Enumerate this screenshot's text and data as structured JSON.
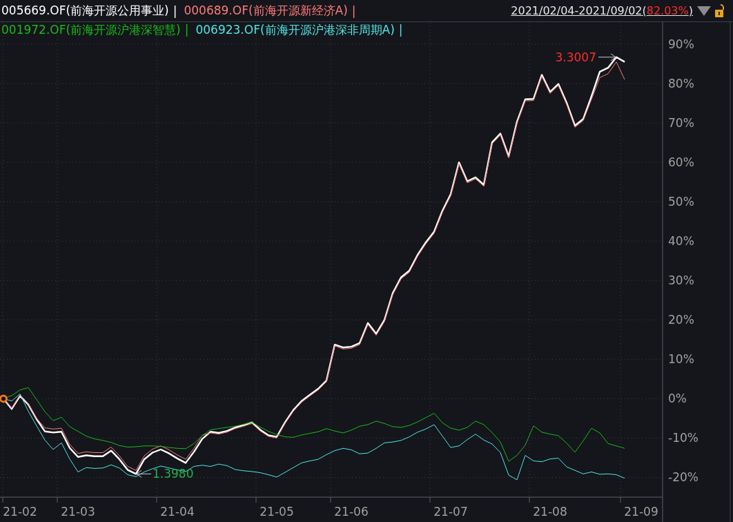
{
  "legend_separator": "|",
  "range": {
    "period": "2021/02/04-2021/09/02",
    "open": "(",
    "change": "82.03%",
    "close": ")"
  },
  "chart_data": {
    "type": "line",
    "grid": true,
    "ylim": [
      -25,
      95.6
    ],
    "categories": [
      null,
      null,
      "21-02",
      null,
      null,
      null,
      null,
      null,
      null,
      "21-03",
      null,
      null,
      null,
      null,
      null,
      null,
      null,
      null,
      null,
      null,
      null,
      "21-04",
      null,
      null,
      null,
      null,
      null,
      null,
      null,
      null,
      null,
      null,
      null,
      "21-05",
      null,
      null,
      null,
      null,
      null,
      null,
      null,
      null,
      "21-06",
      null,
      null,
      null,
      null,
      null,
      null,
      null,
      null,
      null,
      null,
      null,
      "21-07",
      null,
      null,
      null,
      null,
      null,
      null,
      null,
      null,
      null,
      null,
      null,
      "21-08",
      null,
      null,
      null,
      null,
      null,
      null,
      null,
      null,
      null,
      null,
      "21-09",
      null
    ],
    "yticks": [
      {
        "value": -20,
        "label": "-20%"
      },
      {
        "value": -10,
        "label": "-10%"
      },
      {
        "value": 0,
        "label": "0%"
      },
      {
        "value": 10,
        "label": "10%"
      },
      {
        "value": 20,
        "label": "20%"
      },
      {
        "value": 30,
        "label": "30%"
      },
      {
        "value": 40,
        "label": "40%"
      },
      {
        "value": 50,
        "label": "50%"
      },
      {
        "value": 60,
        "label": "60%"
      },
      {
        "value": 70,
        "label": "70%"
      },
      {
        "value": 80,
        "label": "80%"
      },
      {
        "value": 90,
        "label": "90%"
      }
    ],
    "series": [
      {
        "name": "005669.OF(前海开源公用事业)",
        "color": "#ffffff",
        "values": [
          0,
          -2.6,
          0.7,
          -1.5,
          -5.2,
          -8.3,
          -8.6,
          -8.4,
          -12.5,
          -14.8,
          -14.4,
          -14.6,
          -14.6,
          -13.2,
          -15.4,
          -18.1,
          -19.1,
          -15.4,
          -13.7,
          -12.9,
          -13.9,
          -15.2,
          -16.3,
          -13.5,
          -10.2,
          -8.4,
          -8.7,
          -8.2,
          -7.3,
          -6.7,
          -6,
          -7.9,
          -9.3,
          -9.7,
          -6,
          -2.9,
          -0.6,
          1,
          2.5,
          4.6,
          13.7,
          13,
          13.2,
          14.1,
          19.2,
          16.5,
          20,
          26.8,
          30.8,
          32.5,
          36.5,
          39.7,
          42.4,
          47.7,
          51.9,
          60,
          55.2,
          56.2,
          54.3,
          65.1,
          67.3,
          61.5,
          70.3,
          76,
          76.1,
          82.2,
          77.9,
          79.9,
          75.1,
          69.3,
          71,
          76.8,
          83,
          84,
          86.7,
          85.5,
          null,
          null,
          null
        ]
      },
      {
        "name": "000689.OF(前海开源新经济A)",
        "color": "#ff7b7b",
        "values": [
          0,
          -2.4,
          0.9,
          -1.3,
          -5,
          -7.4,
          -7.7,
          -7.5,
          -11.6,
          -13.9,
          -13.5,
          -13.7,
          -13.7,
          -12.3,
          -14.5,
          -17.2,
          -18.2,
          -14.5,
          -12.8,
          -12,
          -13,
          -14.3,
          -15.4,
          -12.6,
          -9.3,
          -8.7,
          -9,
          -8.5,
          -7.6,
          -7,
          -6.3,
          -8.2,
          -9.6,
          -10,
          -6.3,
          -3.2,
          -0.9,
          0.7,
          2.2,
          4.3,
          13.4,
          12.6,
          12.8,
          13.7,
          18.8,
          16.1,
          19.6,
          26.4,
          30.4,
          32.1,
          36.1,
          39.3,
          42,
          47.3,
          51.5,
          59.6,
          54.8,
          55.8,
          53.9,
          64.7,
          66.9,
          61.1,
          69.9,
          75.6,
          75.7,
          81.8,
          77.5,
          79.5,
          74.7,
          68.9,
          70.6,
          76,
          81.5,
          82.5,
          85.5,
          81,
          null,
          null,
          null
        ]
      },
      {
        "name": "001972.OF(前海开源沪港深智慧)",
        "color": "#19b919",
        "values": [
          0,
          0.8,
          2.2,
          2.8,
          -0.2,
          -3.3,
          -5.6,
          -4.7,
          -7.1,
          -8.3,
          -9.5,
          -10.2,
          -10.6,
          -11.1,
          -11.9,
          -12.3,
          -12.2,
          -12,
          -12,
          -12.1,
          -12.4,
          -12.6,
          -12.7,
          -11.4,
          -9.4,
          -7.9,
          -7.6,
          -7.3,
          -7,
          -6.5,
          -6,
          -7.2,
          -8.3,
          -9.1,
          -9.7,
          -9.8,
          -9.2,
          -8.8,
          -8.4,
          -7.6,
          -8.2,
          -8.7,
          -8,
          -7,
          -6.6,
          -5.7,
          -6.3,
          -7.1,
          -7.3,
          -6.8,
          -5.9,
          -4.8,
          -3.7,
          -6.1,
          -7.5,
          -8,
          -7.3,
          -5.7,
          -6.6,
          -8.6,
          -11,
          -15.9,
          -14.4,
          -11.8,
          -6.9,
          -8.5,
          -9,
          -9.4,
          -11.3,
          -13.6,
          -10.7,
          -7.5,
          -8.7,
          -11.4,
          -12,
          -12.6,
          null,
          null,
          null
        ]
      },
      {
        "name": "006923.OF(前海开源沪港深非周期A)",
        "color": "#4ee6e6",
        "values": [
          0,
          -0.6,
          1.2,
          -3.2,
          -6.9,
          -10.5,
          -12.9,
          -11.2,
          -15.3,
          -18.6,
          -17.5,
          -17.7,
          -17.6,
          -16.8,
          -17.6,
          -19.3,
          -19.8,
          -18.6,
          -17.8,
          -17.1,
          -17.6,
          -18.1,
          -18.5,
          -17.2,
          -16.9,
          -17.2,
          -16.6,
          -17,
          -18,
          -18.3,
          -18.5,
          -18.8,
          -19.3,
          -19.9,
          -18.7,
          -17.5,
          -16.3,
          -15.8,
          -15.4,
          -14.2,
          -13.2,
          -12.6,
          -13,
          -14,
          -13.8,
          -12.6,
          -11.2,
          -11,
          -10.6,
          -9.7,
          -8.5,
          -7.7,
          -6.6,
          -9.5,
          -12.4,
          -12,
          -10.4,
          -9,
          -10.5,
          -11.5,
          -13.7,
          -19.4,
          -20.6,
          -14.4,
          -15.8,
          -16,
          -15.3,
          -15.1,
          -17.3,
          -18.2,
          -19.1,
          -18.6,
          -19.2,
          -19.1,
          -19.3,
          -20.2,
          null,
          null,
          null
        ]
      }
    ],
    "annotations": [
      "3.3007",
      "1.3980"
    ]
  }
}
